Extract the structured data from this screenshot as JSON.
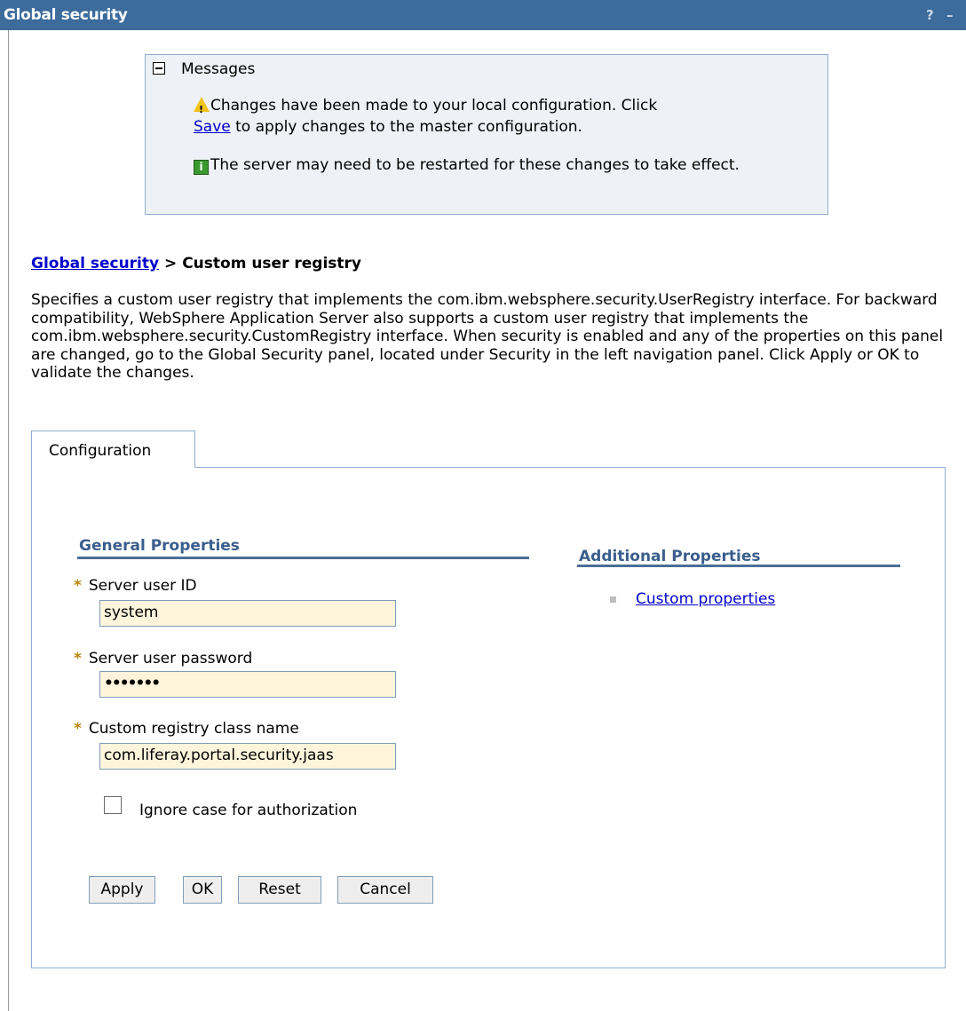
{
  "window": {
    "title": "Global security",
    "help_label": "?",
    "minimize_label": "–"
  },
  "messages": {
    "header": "Messages",
    "warning_pre": "Changes have been made to your local configuration. Click",
    "warning_link": "Save",
    "warning_post": "to apply changes to the master configuration.",
    "info": "The server may need to be restarted for these changes to take effect."
  },
  "breadcrumb": {
    "parent": "Global security",
    "separator": ">",
    "current": "Custom user registry"
  },
  "description": "Specifies a custom user registry that implements the com.ibm.websphere.security.UserRegistry interface. For backward compatibility, WebSphere Application Server also supports a custom user registry that implements the com.ibm.websphere.security.CustomRegistry interface. When security is enabled and any of the properties on this panel are changed, go to the Global Security panel, located under Security in the left navigation panel. Click Apply or OK to validate the changes.",
  "tabs": [
    {
      "label": "Configuration",
      "active": true
    }
  ],
  "general_properties": {
    "title": "General Properties",
    "fields": [
      {
        "label": "Server user ID",
        "required": true,
        "value": "system"
      },
      {
        "label": "Server user password",
        "required": true,
        "value": "•••••••"
      },
      {
        "label": "Custom registry class name",
        "required": true,
        "value": "com.liferay.portal.security.jaas"
      }
    ],
    "checkbox": {
      "label": "Ignore case for authorization",
      "checked": false
    }
  },
  "buttons": {
    "apply": "Apply",
    "ok": "OK",
    "reset": "Reset",
    "cancel": "Cancel"
  },
  "additional_properties": {
    "title": "Additional Properties",
    "links": [
      "Custom properties"
    ]
  },
  "icons": {
    "warning": "warning-triangle-icon",
    "info": "info-icon",
    "required": "required-asterisk-icon"
  },
  "colors": {
    "titlebar": "#3c6b9c",
    "link": "#0000cc",
    "section_heading": "#3a5e8c",
    "input_background": "#fff5dc",
    "message_background": "#eef1f6"
  }
}
